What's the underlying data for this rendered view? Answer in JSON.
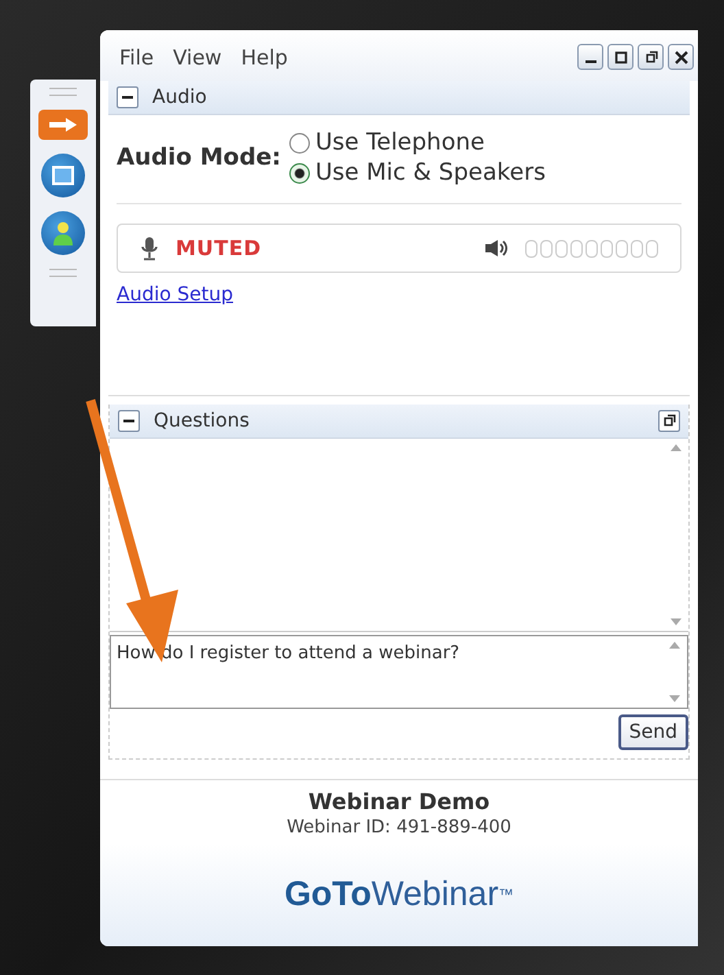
{
  "menu": [
    "File",
    "View",
    "Help"
  ],
  "audio": {
    "title": "Audio",
    "expanded": true,
    "mode_label": "Audio Mode:",
    "options": [
      {
        "label": "Use Telephone",
        "selected": false
      },
      {
        "label": "Use Mic & Speakers",
        "selected": true
      }
    ],
    "mic_status": "MUTED",
    "setup_link": "Audio Setup"
  },
  "questions": {
    "title": "Questions",
    "expanded": true,
    "input": {
      "value": "How do I register to attend a webinar?"
    },
    "send_button": "Send"
  },
  "webinar": {
    "name": "Webinar Demo",
    "id_line": "Webinar ID: 491-889-400"
  },
  "logo": "**GoTo**Webinar$^{™}$"
}
